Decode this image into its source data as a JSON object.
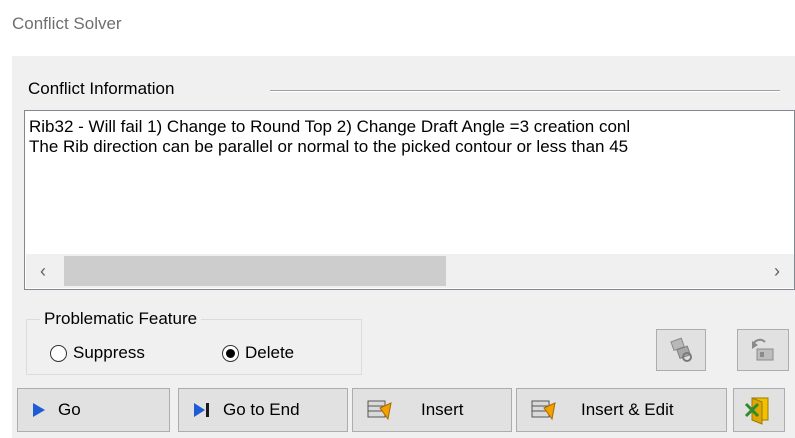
{
  "window": {
    "title": "Conflict Solver"
  },
  "conflict_info": {
    "label": "Conflict Information",
    "lines": [
      "Rib32 - Will fail 1) Change to Round Top 2) Change Draft Angle =3 creation conl",
      "The Rib direction can be parallel or normal to the picked contour or less than 45"
    ]
  },
  "problematic_feature": {
    "label": "Problematic Feature",
    "options": [
      {
        "label": "Suppress",
        "selected": false
      },
      {
        "label": "Delete",
        "selected": true
      }
    ]
  },
  "buttons": {
    "go": "Go",
    "go_to_end": "Go to End",
    "insert": "Insert",
    "insert_edit": "Insert & Edit"
  },
  "icons": {
    "go": "play-arrow-icon",
    "go_to_end": "skip-to-end-icon",
    "insert": "insert-feature-icon",
    "insert_edit": "insert-edit-feature-icon",
    "exit": "exit-icon",
    "locate": "locate-feature-icon",
    "rollback": "rollback-icon"
  },
  "colors": {
    "accent_blue": "#1e5bd7",
    "panel_bg": "#f0f0f0",
    "exit_yellow": "#f2c200"
  }
}
